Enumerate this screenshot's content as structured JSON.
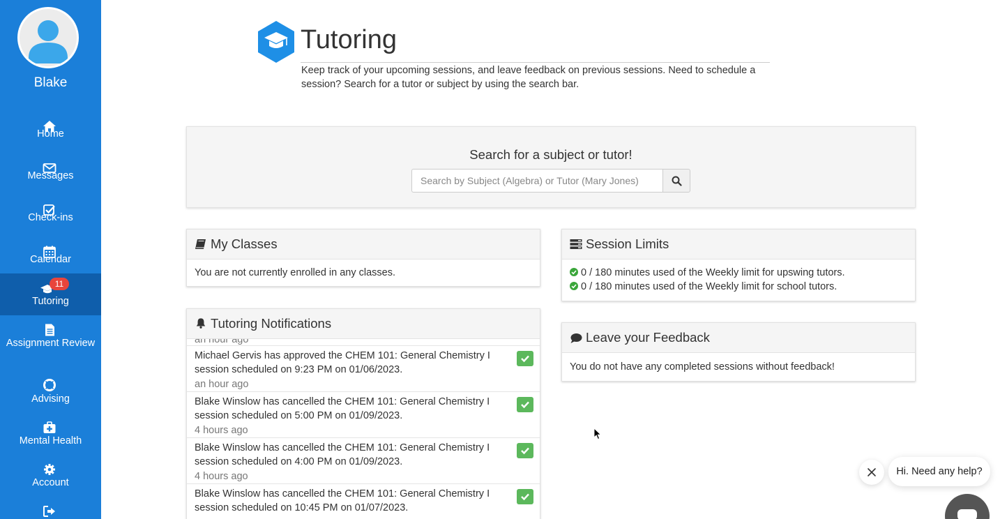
{
  "sidebar": {
    "user_name": "Blake",
    "items": [
      {
        "label": "Home",
        "icon": "home-icon"
      },
      {
        "label": "Messages",
        "icon": "envelope-icon"
      },
      {
        "label": "Check-ins",
        "icon": "checkbox-icon"
      },
      {
        "label": "Calendar",
        "icon": "calendar-icon"
      },
      {
        "label": "Tutoring",
        "icon": "graduation-cap-icon",
        "badge": "11",
        "active": true
      },
      {
        "label": "Assignment Review",
        "icon": "document-icon"
      },
      {
        "label": "Advising",
        "icon": "life-ring-icon"
      },
      {
        "label": "Mental Health",
        "icon": "medkit-icon"
      },
      {
        "label": "Account",
        "icon": "gear-icon"
      },
      {
        "label": "",
        "icon": "sign-out-icon"
      }
    ]
  },
  "header": {
    "title": "Tutoring",
    "description": "Keep track of your upcoming sessions, and leave feedback on previous sessions. Need to schedule a session? Search for a tutor or subject by using the search bar."
  },
  "search": {
    "heading": "Search for a subject or tutor!",
    "placeholder": "Search by Subject (Algebra) or Tutor (Mary Jones)",
    "value": ""
  },
  "my_classes": {
    "title": "My Classes",
    "body": "You are not currently enrolled in any classes."
  },
  "session_limits": {
    "title": "Session Limits",
    "lines": [
      "0 / 180 minutes used of the Weekly limit for upswing tutors.",
      "0 / 180 minutes used of the Weekly limit for school tutors."
    ]
  },
  "feedback": {
    "title": "Leave your Feedback",
    "body": "You do not have any completed sessions without feedback!"
  },
  "notifications": {
    "title": "Tutoring Notifications",
    "partial_time": "an hour ago",
    "items": [
      {
        "text": "Michael Gervis has approved the CHEM 101: General Chemistry I session scheduled on 9:23 PM on 01/06/2023.",
        "time": "an hour ago"
      },
      {
        "text": "Blake Winslow has cancelled the CHEM 101: General Chemistry I session scheduled on 5:00 PM on 01/09/2023.",
        "time": "4 hours ago"
      },
      {
        "text": "Blake Winslow has cancelled the CHEM 101: General Chemistry I session scheduled on 4:00 PM on 01/09/2023.",
        "time": "4 hours ago"
      },
      {
        "text": "Blake Winslow has cancelled the CHEM 101: General Chemistry I session scheduled on 10:45 PM on 01/07/2023.",
        "time": ""
      }
    ]
  },
  "chat": {
    "message": "Hi. Need any help?"
  },
  "colors": {
    "sidebar": "#1b7fd9",
    "sidebar_active": "#0f5eab",
    "badge": "#e8453c",
    "success": "#5cb85c",
    "logo": "#1e8fe6"
  }
}
